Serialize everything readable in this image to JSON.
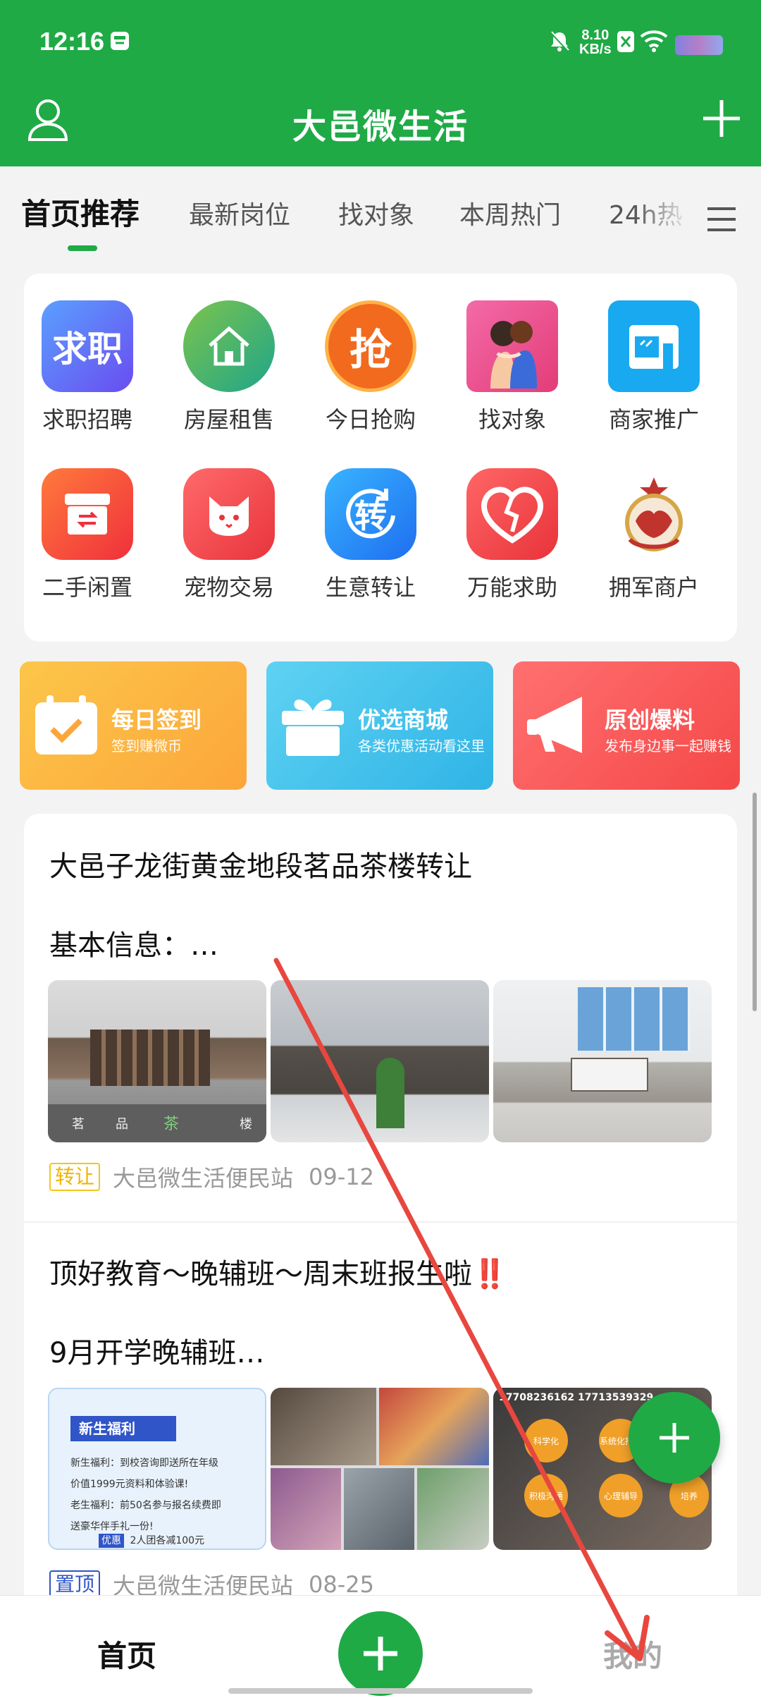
{
  "status": {
    "time": "12:16",
    "speed_value": "8.10",
    "speed_unit": "KB/s"
  },
  "app": {
    "title": "大邑微生活"
  },
  "tabs": [
    "首页推荐",
    "最新岗位",
    "找对象",
    "本周热门",
    "24h热"
  ],
  "categories": [
    {
      "label": "求职招聘",
      "icon": "job-icon",
      "icon_text": "求职",
      "color": "#3c79f0"
    },
    {
      "label": "房屋租售",
      "icon": "house-icon",
      "color": "#3db36a"
    },
    {
      "label": "今日抢购",
      "icon": "flash-sale-icon",
      "icon_text": "抢",
      "color": "#f0621e"
    },
    {
      "label": "找对象",
      "icon": "couple-icon",
      "color": "#ec4c8a"
    },
    {
      "label": "商家推广",
      "icon": "shop-icon",
      "color": "#1aa7f2"
    },
    {
      "label": "二手闲置",
      "icon": "secondhand-icon",
      "color": "#f2473b"
    },
    {
      "label": "宠物交易",
      "icon": "pet-icon",
      "color": "#f04a4a"
    },
    {
      "label": "生意转让",
      "icon": "transfer-icon",
      "icon_text": "转",
      "color": "#1f8ef0"
    },
    {
      "label": "万能求助",
      "icon": "heart-icon",
      "color": "#ef4545"
    },
    {
      "label": "拥军商户",
      "icon": "army-badge-icon",
      "color": "#c0342d"
    }
  ],
  "banners": [
    {
      "title": "每日签到",
      "subtitle": "签到赚微币",
      "color": "#fbb03b",
      "icon": "calendar-check-icon"
    },
    {
      "title": "优选商城",
      "subtitle": "各类优惠活动看这里",
      "color": "#4cc8ec",
      "icon": "gift-icon"
    },
    {
      "title": "原创爆料",
      "subtitle": "发布身边事一起赚钱",
      "color": "#f85c5c",
      "icon": "megaphone-icon"
    }
  ],
  "posts": [
    {
      "title": "大邑子龙街黄金地段茗品茶楼转让",
      "summary": "基本信息：…",
      "tag": "转让",
      "tag_color": "#f5c518",
      "source": "大邑微生活便民站",
      "date": "09-12",
      "photo_text": [
        "茗",
        "品",
        "茶",
        "楼"
      ]
    },
    {
      "title": "顶好教育～晚辅班～周末班报生啦‼️",
      "summary": "9月开学晚辅班…",
      "tag": "置顶",
      "tag_color": "#2f55c8",
      "source": "大邑微生活便民站",
      "date": "08-25",
      "flyer": {
        "heading": "新生福利",
        "line1": "新生福利：到校咨询即送所在年级",
        "line2": "价值1999元资料和体验课!",
        "line3": "老生福利：前50名参与报名续费即",
        "line4": "送豪华伴手礼一份!",
        "badge_tag": "优惠",
        "badge": "2人团各减100元"
      },
      "flyer2": {
        "phones": "17708236162  17713539329",
        "bubbles": [
          "科学化",
          "系统化托管",
          "积极沟通",
          "心理辅导",
          "培养"
        ]
      }
    }
  ],
  "nav": {
    "home": "首页",
    "mine": "我的"
  }
}
